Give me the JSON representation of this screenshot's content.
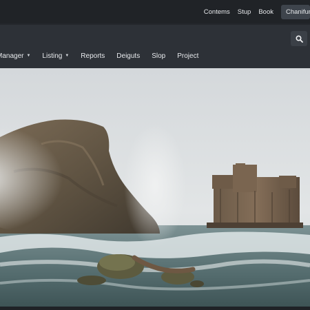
{
  "topbar": {
    "links": [
      "Contems",
      "Stup",
      "Book"
    ],
    "cta_label": "Chanifurt"
  },
  "navbar": {
    "items": [
      {
        "label": "Manager",
        "has_dropdown": true
      },
      {
        "label": "Listing",
        "has_dropdown": true
      },
      {
        "label": "Reports",
        "has_dropdown": false
      },
      {
        "label": "Deiguts",
        "has_dropdown": false
      },
      {
        "label": "Slop",
        "has_dropdown": false
      },
      {
        "label": "Project",
        "has_dropdown": false
      }
    ],
    "search_icon": "search-icon"
  },
  "hero": {
    "subject": "sea-stack-and-castle-ruin-in-fog"
  },
  "colors": {
    "topbar_bg": "#202327",
    "navbar_bg": "#2d3137",
    "text": "#e8eaed"
  }
}
